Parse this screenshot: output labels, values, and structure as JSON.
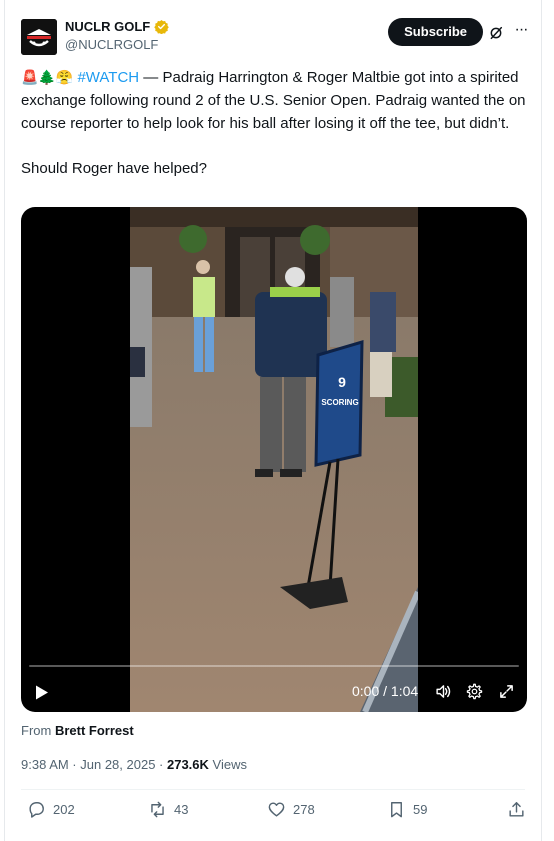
{
  "account": {
    "display_name": "NUCLR GOLF",
    "handle": "@NUCLRGOLF",
    "verified_color": "#e8b80a"
  },
  "header": {
    "subscribe_label": "Subscribe",
    "more_label": "···"
  },
  "tweet": {
    "emojis": "🚨🌲😤",
    "hashtag": "#WATCH",
    "body": " — Padraig Harrington & Roger Maltbie got into a spirited exchange following round 2 of the U.S. Senior Open. Padraig wanted the on course reporter to help look for his ball after losing it off the tee, but didn’t.",
    "question": "Should Roger have helped?"
  },
  "video": {
    "sign_number": "9",
    "sign_text": "SCORING",
    "time": "0:00 / 1:04",
    "progress": 0
  },
  "source": {
    "prefix": "From ",
    "name": "Brett Forrest"
  },
  "meta": {
    "timestamp": "9:38 AM · Jun 28, 2025 · ",
    "views_count": "273.6K",
    "views_label": " Views"
  },
  "actions": {
    "replies": "202",
    "reposts": "43",
    "likes": "278",
    "bookmarks": "59"
  },
  "colors": {
    "accent": "#1d9bf0",
    "text": "#0f1419",
    "muted": "#536471"
  }
}
